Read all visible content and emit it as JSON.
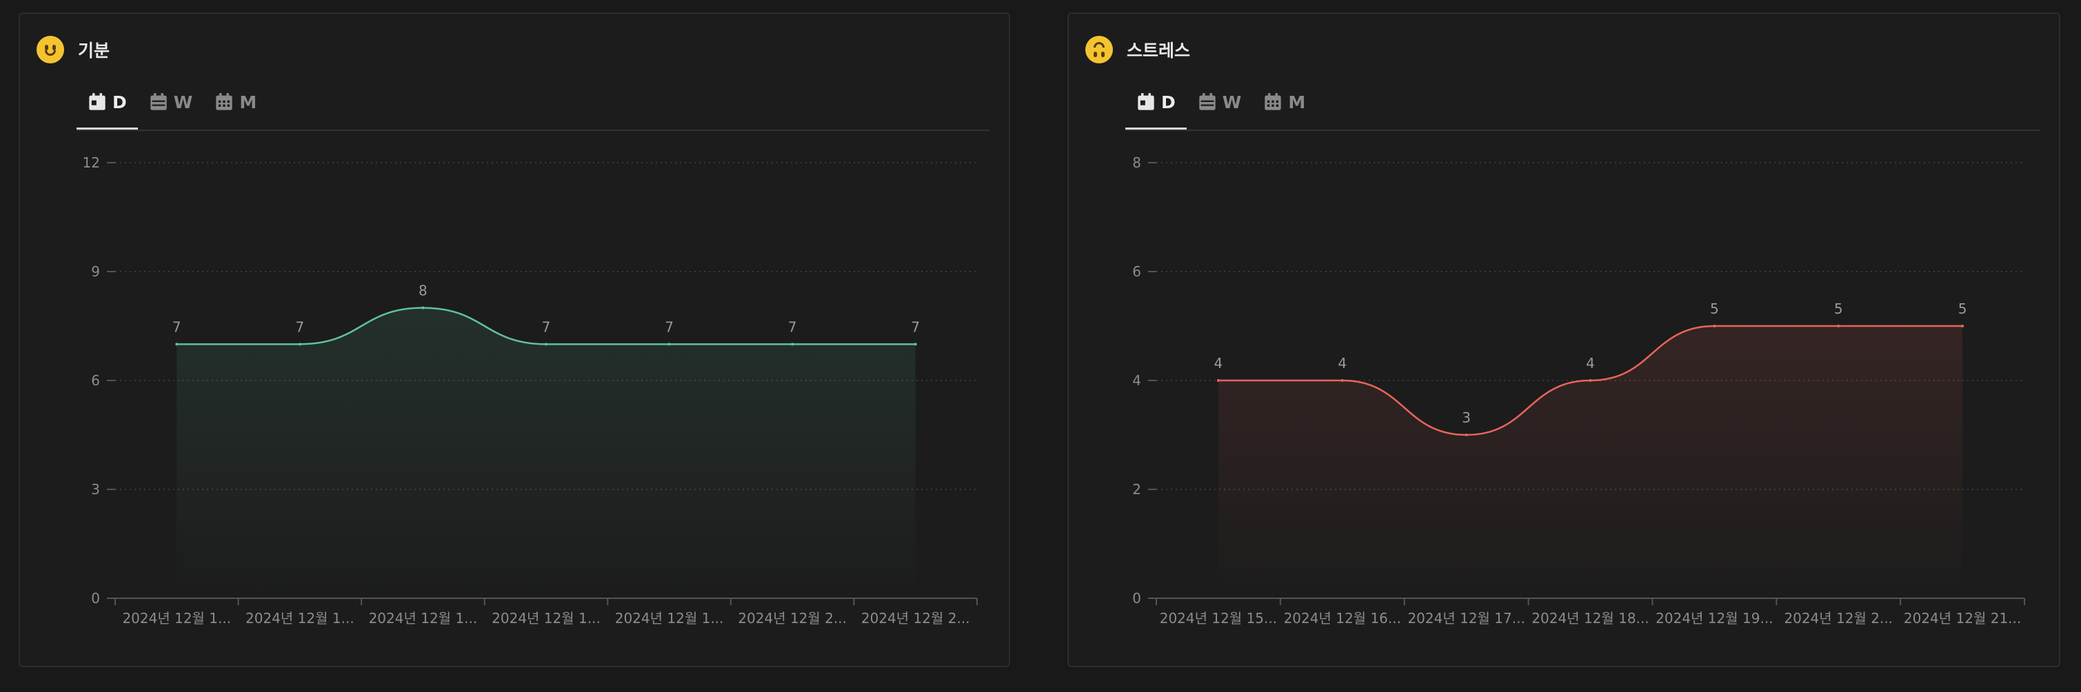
{
  "panels": [
    {
      "title": "기분",
      "tabs": [
        {
          "label": "D",
          "active": true
        },
        {
          "label": "W",
          "active": false
        },
        {
          "label": "M",
          "active": false
        }
      ]
    },
    {
      "title": "스트레스",
      "tabs": [
        {
          "label": "D",
          "active": true
        },
        {
          "label": "W",
          "active": false
        },
        {
          "label": "M",
          "active": false
        }
      ]
    }
  ],
  "chart_data": [
    {
      "type": "area",
      "title": "기분",
      "categories": [
        "2024년 12월 1...",
        "2024년 12월 1...",
        "2024년 12월 1...",
        "2024년 12월 1...",
        "2024년 12월 1...",
        "2024년 12월 2...",
        "2024년 12월 2..."
      ],
      "values": [
        7,
        7,
        8,
        7,
        7,
        7,
        7
      ],
      "yticks": [
        0,
        3,
        6,
        9,
        12
      ],
      "ylim": [
        0,
        12
      ],
      "grid": true,
      "color": "#5ec49a"
    },
    {
      "type": "area",
      "title": "스트레스",
      "categories": [
        "2024년 12월 15...",
        "2024년 12월 16...",
        "2024년 12월 17...",
        "2024년 12월 18...",
        "2024년 12월 19...",
        "2024년 12월 2...",
        "2024년 12월 21..."
      ],
      "values": [
        4,
        4,
        3,
        4,
        5,
        5,
        5
      ],
      "yticks": [
        0,
        2,
        4,
        6,
        8
      ],
      "ylim": [
        0,
        8
      ],
      "grid": true,
      "color": "#e8655a"
    }
  ]
}
